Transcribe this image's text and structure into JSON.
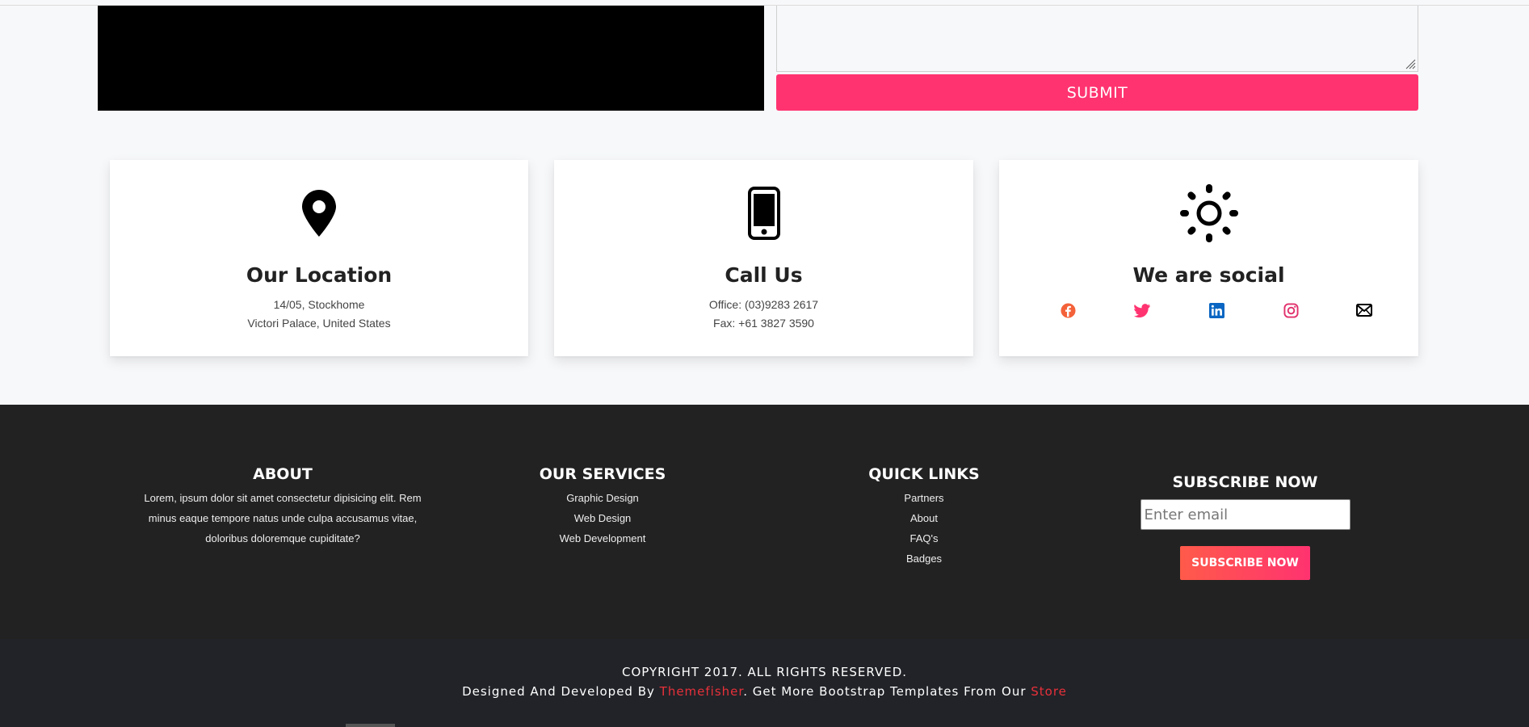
{
  "contact_form": {
    "submit_label": "SUBMIT"
  },
  "info_cards": [
    {
      "icon": "location-pin-icon",
      "title": "Our Location",
      "line1": "14/05, Stockhome",
      "line2": "Victori Palace, United States"
    },
    {
      "icon": "mobile-phone-icon",
      "title": "Call Us",
      "line1": "Office: (03)9283 2617",
      "line2": "Fax: +61 3827 3590"
    },
    {
      "icon": "sun-icon",
      "title": "We are social",
      "social": [
        "facebook-icon",
        "twitter-icon",
        "linkedin-icon",
        "instagram-icon",
        "email-icon"
      ]
    }
  ],
  "footer": {
    "about": {
      "heading": "ABOUT",
      "text": "Lorem, ipsum dolor sit amet consectetur dipisicing elit. Rem minus eaque tempore natus unde culpa accusamus vitae, doloribus doloremque cupiditate?"
    },
    "services": {
      "heading": "OUR SERVICES",
      "items": [
        "Graphic Design",
        "Web Design",
        "Web Development"
      ]
    },
    "quick_links": {
      "heading": "QUICK LINKS",
      "items": [
        "Partners",
        "About",
        "FAQ's",
        "Badges"
      ]
    },
    "subscribe": {
      "heading": "SUBSCRIBE NOW",
      "placeholder": "Enter email",
      "button_label": "SUBSCRIBE NOW"
    }
  },
  "bottom_bar": {
    "copyright": "COPYRIGHT 2017. ALL RIGHTS RESERVED.",
    "credit_prefix": "Designed And Developed By ",
    "credit_link1": "Themefisher",
    "credit_middle": ". Get More Bootstrap Templates From Our ",
    "credit_link2": "Store"
  },
  "colors": {
    "accent": "#ff3370",
    "footer_bg": "#222222",
    "bottom_bar_bg": "#212328",
    "link_red": "#e8303a",
    "facebook": "#f4623a",
    "twitter": "#ff3370",
    "linkedin": "#0a66c2",
    "instagram": "#e1306c"
  }
}
